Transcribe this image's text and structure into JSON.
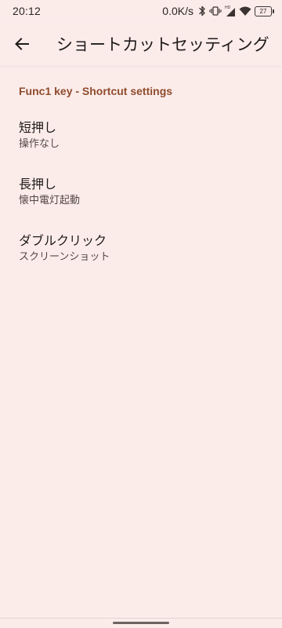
{
  "status_bar": {
    "time": "20:12",
    "net_speed": "0.0K/s",
    "battery_level": "27",
    "icons": [
      "bluetooth-icon",
      "vibrate-icon",
      "hd-signal-icon",
      "wifi-icon",
      "battery-icon"
    ]
  },
  "app_bar": {
    "title": "ショートカットセッティング",
    "back_icon": "back-arrow-icon"
  },
  "section": {
    "header": "Func1 key - Shortcut settings",
    "items": [
      {
        "title": "短押し",
        "summary": "操作なし"
      },
      {
        "title": "長押し",
        "summary": "懐中電灯起動"
      },
      {
        "title": "ダブルクリック",
        "summary": "スクリーンショット"
      }
    ]
  },
  "colors": {
    "background": "#fbecea",
    "accent": "#8f4c2c",
    "text_primary": "#1f1a19",
    "text_secondary": "#544846"
  }
}
